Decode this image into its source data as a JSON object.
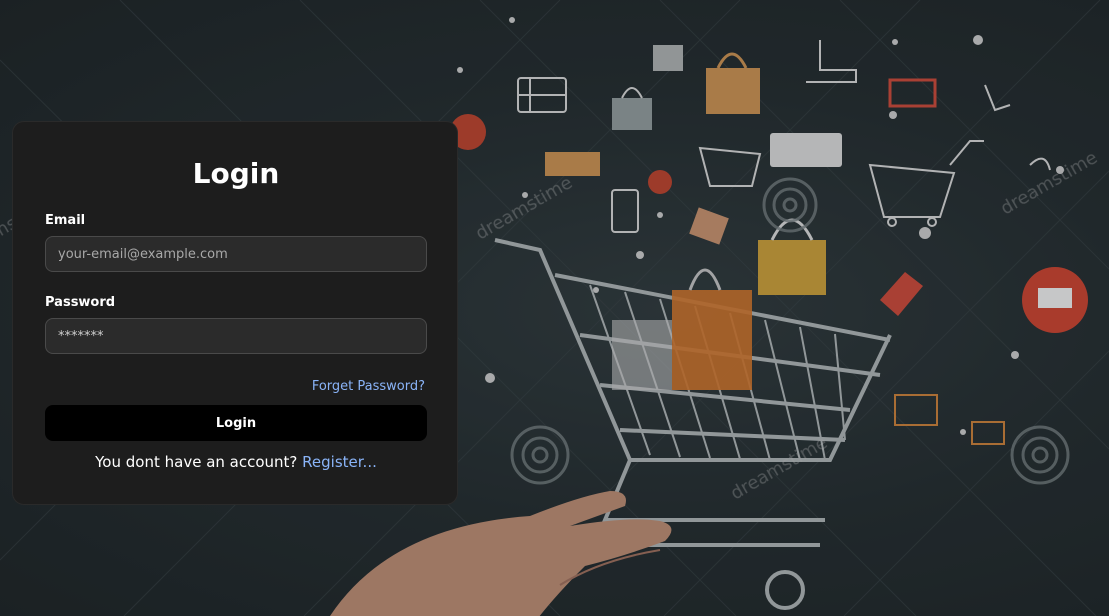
{
  "login_form": {
    "title": "Login",
    "email_label": "Email",
    "email_placeholder": "your-email@example.com",
    "email_value": "",
    "password_label": "Password",
    "password_value": "*******",
    "forgot_link": "Forget Password?",
    "submit_label": "Login",
    "register_prompt": "You dont have an account?",
    "register_link": "Register..."
  },
  "background": {
    "watermark": "dreamstime",
    "colors": {
      "background": "#232c2f",
      "card": "#1d1d1d",
      "link": "#8ab4f8",
      "accent_orange": "#e07b2a",
      "accent_red": "#d94b3a"
    }
  }
}
